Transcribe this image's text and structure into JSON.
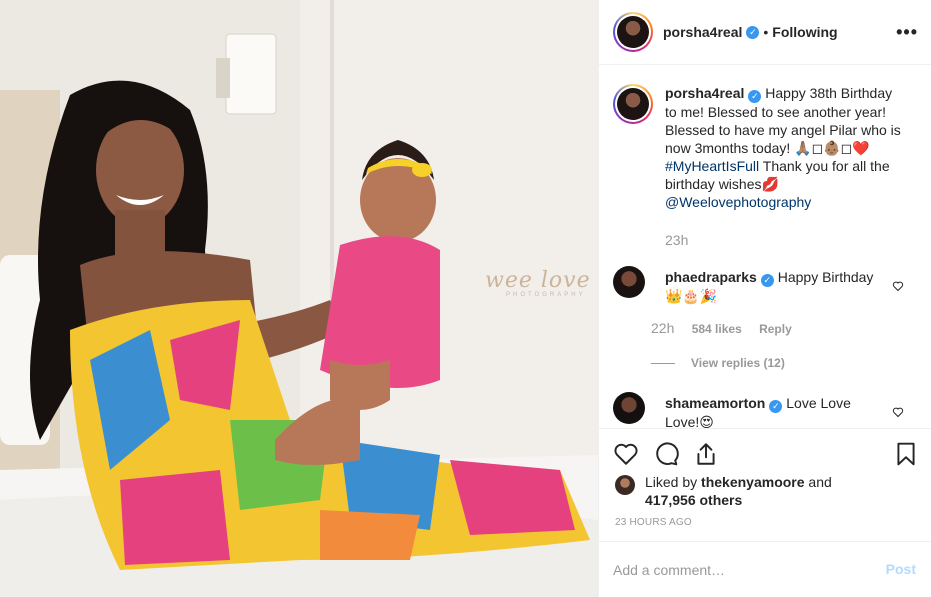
{
  "post": {
    "photo": {
      "watermark": "wee love",
      "watermark_sub": "PHOTOGRAPHY",
      "colors": {
        "wall": "#e9e6e0",
        "bed": "#f4f3f1",
        "dress_a": "#f2c531",
        "dress_b": "#3b8fd1",
        "dress_c": "#e5417e",
        "dress_d": "#6cc04a",
        "romper": "#e94a86"
      }
    },
    "header": {
      "username": "porsha4real",
      "separator": "•",
      "follow_status": "Following",
      "more_icon": "more-horizontal-icon",
      "more_label": "•••"
    },
    "caption": {
      "username": "porsha4real",
      "text_1": "Happy 38th Birthday to me! Blessed to see another year! Blessed to have my angel Pilar who is now 3months today! 🙏🏽◻👶🏽◻❤️",
      "hashtag": "#MyHeartIsFull",
      "text_2": "Thank you for all the birthday wishes💋",
      "mention": "@Weelovephotography",
      "time": "23h"
    },
    "comments": [
      {
        "username": "phaedraparks",
        "text": "Happy Birthday 👑🎂🎉",
        "time": "22h",
        "likes": "584 likes",
        "reply": "Reply",
        "view_replies": "View replies (12)"
      },
      {
        "username": "shameamorton",
        "text": "Love Love Love!😍"
      }
    ],
    "actions": {
      "like_icon": "heart-icon",
      "comment_icon": "comment-icon",
      "share_icon": "share-icon",
      "save_icon": "bookmark-icon"
    },
    "liked_by": {
      "prefix": "Liked by",
      "user": "thekenyamoore",
      "suffix": "and",
      "count": "417,956 others"
    },
    "timestamp": "23 HOURS AGO",
    "comment_box": {
      "placeholder": "Add a comment…",
      "post_label": "Post",
      "post_color": "#b3dbff"
    },
    "accent": "#3897f0"
  }
}
